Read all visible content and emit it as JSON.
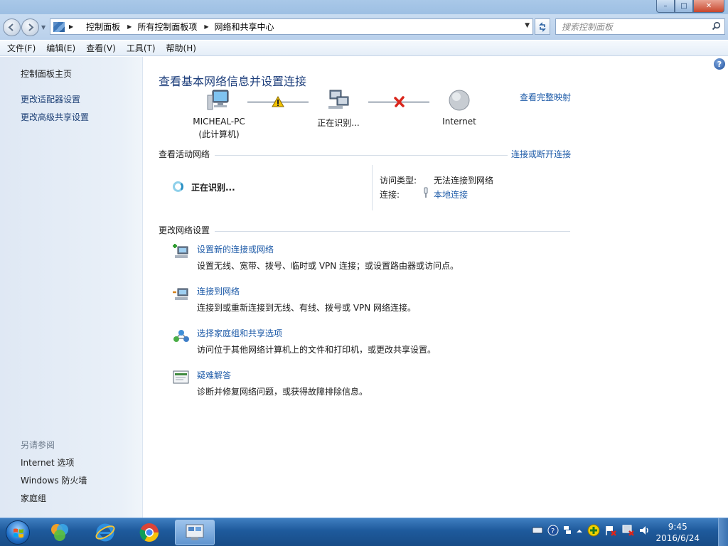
{
  "window": {
    "caption_min": "–",
    "caption_max": "□",
    "caption_close": "✕"
  },
  "address": {
    "crumbs": [
      "控制面板",
      "所有控制面板项",
      "网络和共享中心"
    ],
    "search_placeholder": "搜索控制面板"
  },
  "menu": [
    "文件(F)",
    "编辑(E)",
    "查看(V)",
    "工具(T)",
    "帮助(H)"
  ],
  "sidebar": {
    "links": [
      "控制面板主页",
      "更改适配器设置",
      "更改高级共享设置"
    ],
    "see_also_heading": "另请参阅",
    "see_also": [
      "Internet 选项",
      "Windows 防火墙",
      "家庭组"
    ]
  },
  "main": {
    "title": "查看基本网络信息并设置连接",
    "full_map_link": "查看完整映射",
    "map": {
      "computer_name": "MICHEAL-PC",
      "computer_sub": "(此计算机)",
      "network_label": "正在识别...",
      "internet_label": "Internet"
    },
    "active_section": {
      "heading": "查看活动网络",
      "connect_link": "连接或断开连接",
      "network_status": "正在识别...",
      "access_type_label": "访问类型:",
      "access_type_value": "无法连接到网络",
      "connection_label": "连接:",
      "connection_value": "本地连接"
    },
    "change_section": {
      "heading": "更改网络设置",
      "tasks": [
        {
          "link": "设置新的连接或网络",
          "desc": "设置无线、宽带、拨号、临时或 VPN 连接；或设置路由器或访问点。"
        },
        {
          "link": "连接到网络",
          "desc": "连接到或重新连接到无线、有线、拨号或 VPN 网络连接。"
        },
        {
          "link": "选择家庭组和共享选项",
          "desc": "访问位于其他网络计算机上的文件和打印机，或更改共享设置。"
        },
        {
          "link": "疑难解答",
          "desc": "诊断并修复网络问题，或获得故障排除信息。"
        }
      ]
    }
  },
  "taskbar": {
    "clock_time": "9:45",
    "clock_date": "2016/6/24"
  },
  "colors": {
    "link": "#1e5ba8",
    "title": "#1e3f7c",
    "taskbar": "#1e5a9c",
    "error_x": "#d9261c",
    "warning": "#f2c200"
  }
}
